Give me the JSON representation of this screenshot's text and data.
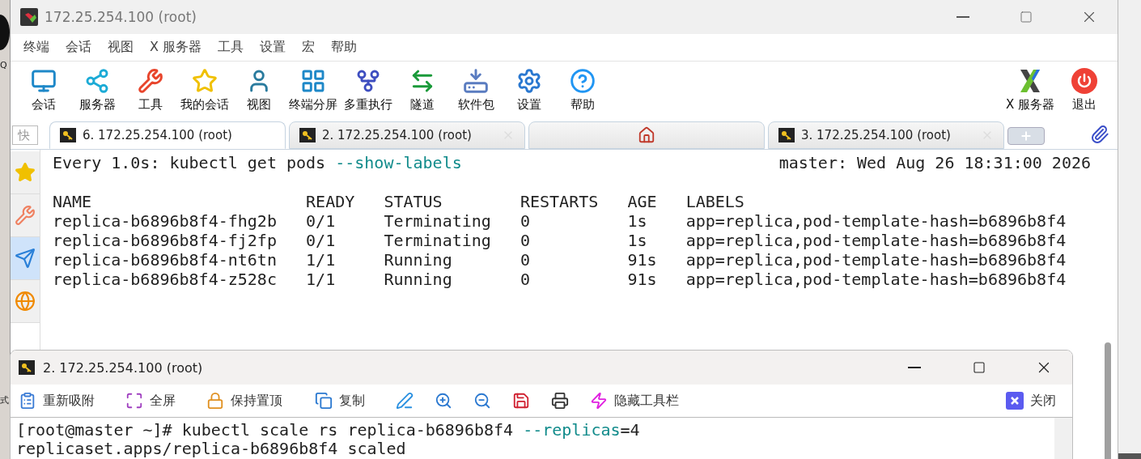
{
  "desktop": {
    "fragments": [
      "Q",
      "式"
    ]
  },
  "window": {
    "title": "172.25.254.100 (root)"
  },
  "menu": [
    "终端",
    "会话",
    "视图",
    "X 服务器",
    "工具",
    "设置",
    "宏",
    "帮助"
  ],
  "toolbar": {
    "left": [
      "会话",
      "服务器",
      "工具",
      "我的会话",
      "视图",
      "终端分屏",
      "多重执行",
      "隧道",
      "软件包",
      "设置",
      "帮助"
    ],
    "right": [
      "X 服务器",
      "退出"
    ]
  },
  "quick_field": {
    "value": "快"
  },
  "tabs": [
    {
      "kind": "session",
      "label": "6. 172.25.254.100 (root)",
      "selected": true
    },
    {
      "kind": "session",
      "label": "2. 172.25.254.100 (root)",
      "selected": false
    },
    {
      "kind": "home",
      "selected": false
    },
    {
      "kind": "session",
      "label": "3. 172.25.254.100 (root)",
      "selected": false
    }
  ],
  "sidebar": {
    "items": [
      {
        "selected": false
      },
      {
        "selected": false
      },
      {
        "selected": true
      },
      {
        "selected": false
      }
    ]
  },
  "terminal": {
    "header": {
      "command": "Every 1.0s: kubectl get pods",
      "option": "--show-labels",
      "clock": "master: Wed Aug 26 18:31:00 2026"
    },
    "table": {
      "columns": [
        "NAME",
        "READY",
        "STATUS",
        "RESTARTS",
        "AGE",
        "LABELS"
      ],
      "rows": [
        [
          "replica-b6896b8f4-fhg2b",
          "0/1",
          "Terminating",
          "0",
          "1s",
          "app=replica,pod-template-hash=b6896b8f4"
        ],
        [
          "replica-b6896b8f4-fj2fp",
          "0/1",
          "Terminating",
          "0",
          "1s",
          "app=replica,pod-template-hash=b6896b8f4"
        ],
        [
          "replica-b6896b8f4-nt6tn",
          "1/1",
          "Running",
          "0",
          "91s",
          "app=replica,pod-template-hash=b6896b8f4"
        ],
        [
          "replica-b6896b8f4-z528c",
          "1/1",
          "Running",
          "0",
          "91s",
          "app=replica,pod-template-hash=b6896b8f4"
        ]
      ]
    }
  },
  "detached_window": {
    "title": "2. 172.25.254.100 (root)",
    "toolbar": [
      {
        "kind": "labeled",
        "label": "重新吸附"
      },
      {
        "kind": "labeled",
        "label": "全屏"
      },
      {
        "kind": "labeled",
        "label": "保持置顶"
      },
      {
        "kind": "labeled",
        "label": "复制"
      },
      {
        "kind": "icon"
      },
      {
        "kind": "icon"
      },
      {
        "kind": "icon"
      },
      {
        "kind": "icon"
      },
      {
        "kind": "icon"
      },
      {
        "kind": "labeled",
        "label": "隐藏工具栏"
      }
    ],
    "close": {
      "label": "关闭"
    },
    "lines": [
      {
        "prompt": "[root@master ~]# kubectl scale rs replica-b6896b8f4",
        "option": "--replicas",
        "rest": "=4"
      },
      {
        "prompt": "replicaset.apps/replica-b6896b8f4 scaled"
      }
    ]
  }
}
